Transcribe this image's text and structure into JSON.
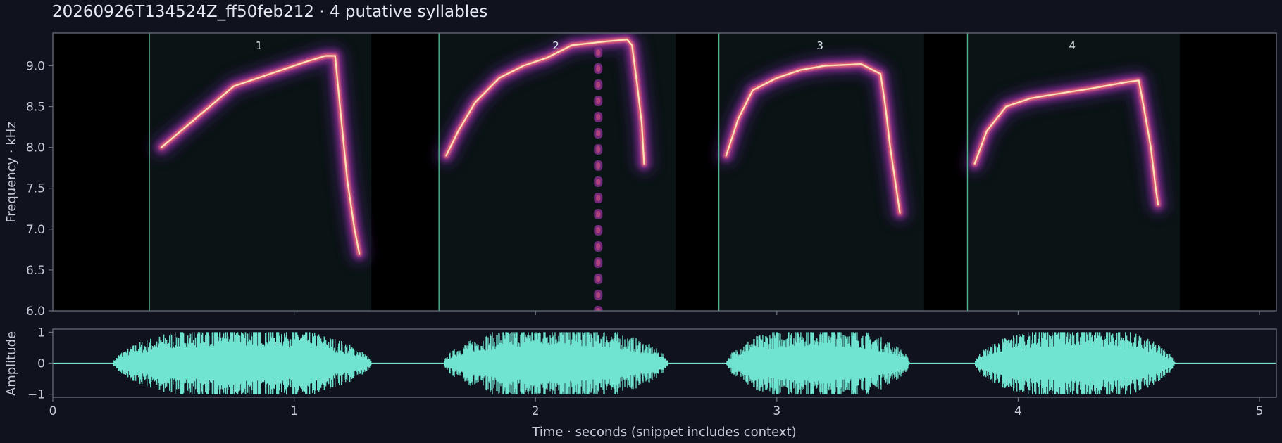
{
  "title": "20260926T134524Z_ff50feb212  ·  4 putative syllables",
  "chart_data": [
    {
      "type": "heatmap",
      "name": "spectrogram",
      "ylabel": "Frequency · kHz",
      "xlim": [
        0,
        5.07
      ],
      "ylim": [
        6.0,
        9.4
      ],
      "x_ticks": [
        1,
        2,
        3,
        4,
        5
      ],
      "y_ticks": [
        "6.0",
        "6.5",
        "7.0",
        "7.5",
        "8.0",
        "8.5",
        "9.0"
      ],
      "syllables": [
        {
          "label": "1",
          "onset": 0.4,
          "offset": 1.32,
          "trace": [
            [
              0.45,
              8.0
            ],
            [
              0.55,
              8.25
            ],
            [
              0.65,
              8.5
            ],
            [
              0.75,
              8.75
            ],
            [
              0.85,
              8.85
            ],
            [
              0.95,
              8.95
            ],
            [
              1.05,
              9.05
            ],
            [
              1.13,
              9.12
            ],
            [
              1.17,
              9.12
            ],
            [
              1.18,
              8.8
            ],
            [
              1.2,
              8.2
            ],
            [
              1.22,
              7.6
            ],
            [
              1.25,
              7.0
            ],
            [
              1.27,
              6.7
            ]
          ]
        },
        {
          "label": "2",
          "onset": 1.6,
          "offset": 2.58,
          "trace": [
            [
              1.63,
              7.9
            ],
            [
              1.68,
              8.2
            ],
            [
              1.75,
              8.55
            ],
            [
              1.85,
              8.85
            ],
            [
              1.95,
              9.0
            ],
            [
              2.05,
              9.1
            ],
            [
              2.15,
              9.25
            ],
            [
              2.3,
              9.3
            ],
            [
              2.38,
              9.32
            ],
            [
              2.4,
              9.25
            ],
            [
              2.42,
              8.8
            ],
            [
              2.44,
              8.3
            ],
            [
              2.45,
              7.8
            ]
          ]
        },
        {
          "label": "3",
          "onset": 2.76,
          "offset": 3.61,
          "trace": [
            [
              2.79,
              7.9
            ],
            [
              2.84,
              8.35
            ],
            [
              2.9,
              8.7
            ],
            [
              3.0,
              8.85
            ],
            [
              3.1,
              8.95
            ],
            [
              3.2,
              9.0
            ],
            [
              3.35,
              9.02
            ],
            [
              3.43,
              8.9
            ],
            [
              3.45,
              8.5
            ],
            [
              3.47,
              8.0
            ],
            [
              3.5,
              7.4
            ],
            [
              3.51,
              7.2
            ]
          ]
        },
        {
          "label": "4",
          "onset": 3.79,
          "offset": 4.67,
          "trace": [
            [
              3.82,
              7.8
            ],
            [
              3.87,
              8.2
            ],
            [
              3.95,
              8.5
            ],
            [
              4.05,
              8.6
            ],
            [
              4.15,
              8.65
            ],
            [
              4.3,
              8.72
            ],
            [
              4.45,
              8.8
            ],
            [
              4.5,
              8.82
            ],
            [
              4.52,
              8.5
            ],
            [
              4.55,
              8.0
            ],
            [
              4.57,
              7.5
            ],
            [
              4.58,
              7.3
            ]
          ]
        }
      ],
      "vertical_streak_x": 2.26
    },
    {
      "type": "line",
      "name": "waveform",
      "ylabel": "Amplitude",
      "xlabel": "Time · seconds (snippet includes context)",
      "xlim": [
        0,
        5.07
      ],
      "ylim": [
        -1.1,
        1.1
      ],
      "x_ticks": [
        "0",
        "1",
        "2",
        "3",
        "4",
        "5"
      ],
      "y_ticks": [
        "1",
        "0",
        "−1"
      ],
      "bursts": [
        {
          "start": 0.25,
          "end": 1.32,
          "peak": 1.0
        },
        {
          "start": 1.62,
          "end": 2.55,
          "peak": 1.0
        },
        {
          "start": 2.79,
          "end": 3.55,
          "peak": 1.0
        },
        {
          "start": 3.82,
          "end": 4.65,
          "peak": 1.0
        }
      ]
    }
  ],
  "colors": {
    "background": "#10131e",
    "axes_spine": "#6e7282",
    "onset_line": "#4fb38e",
    "waveform": "#70e4d0",
    "spectrogram_bg": "#000000",
    "syllable_shade": "#0a1414"
  }
}
